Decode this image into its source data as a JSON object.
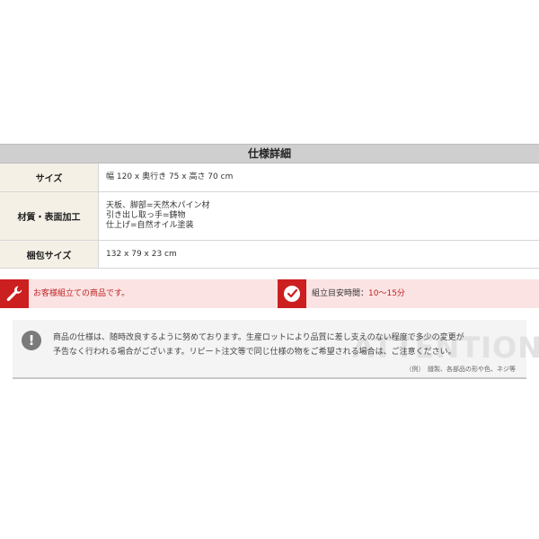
{
  "spec": {
    "title": "仕様詳細",
    "rows": [
      {
        "label": "サイズ",
        "lines": [
          "幅 120 x 奥行き 75 x 高さ 70 cm"
        ]
      },
      {
        "label": "材質・表面加工",
        "lines": [
          "天板、脚部=天然木パイン材",
          "引き出し取っ手=鋳物",
          "仕上げ=自然オイル塗装"
        ]
      },
      {
        "label": "梱包サイズ",
        "lines": [
          "132 x 79 x 23 cm"
        ]
      }
    ]
  },
  "notice": {
    "assembly_text": "お客様組立ての商品です。",
    "time_label": "組立目安時間：",
    "time_value": "10〜15分",
    "icons": {
      "assembly": "wrench-icon",
      "time": "clock-icon"
    },
    "accent_color": "#cc1f1f",
    "bar_color": "#fbe3e3"
  },
  "caution": {
    "icon_symbol": "!",
    "line1": "商品の仕様は、随時改良するように努めております。生産ロットにより品質に差し支えのない程度で多少の変更が",
    "line2": "予告なく行われる場合がございます。リピート注文等で同じ仕様の物をご希望される場合は、ご注意ください。",
    "watermark": "ATTENTION",
    "note": "（例）　縫製、各部品の形や色、ネジ等"
  }
}
